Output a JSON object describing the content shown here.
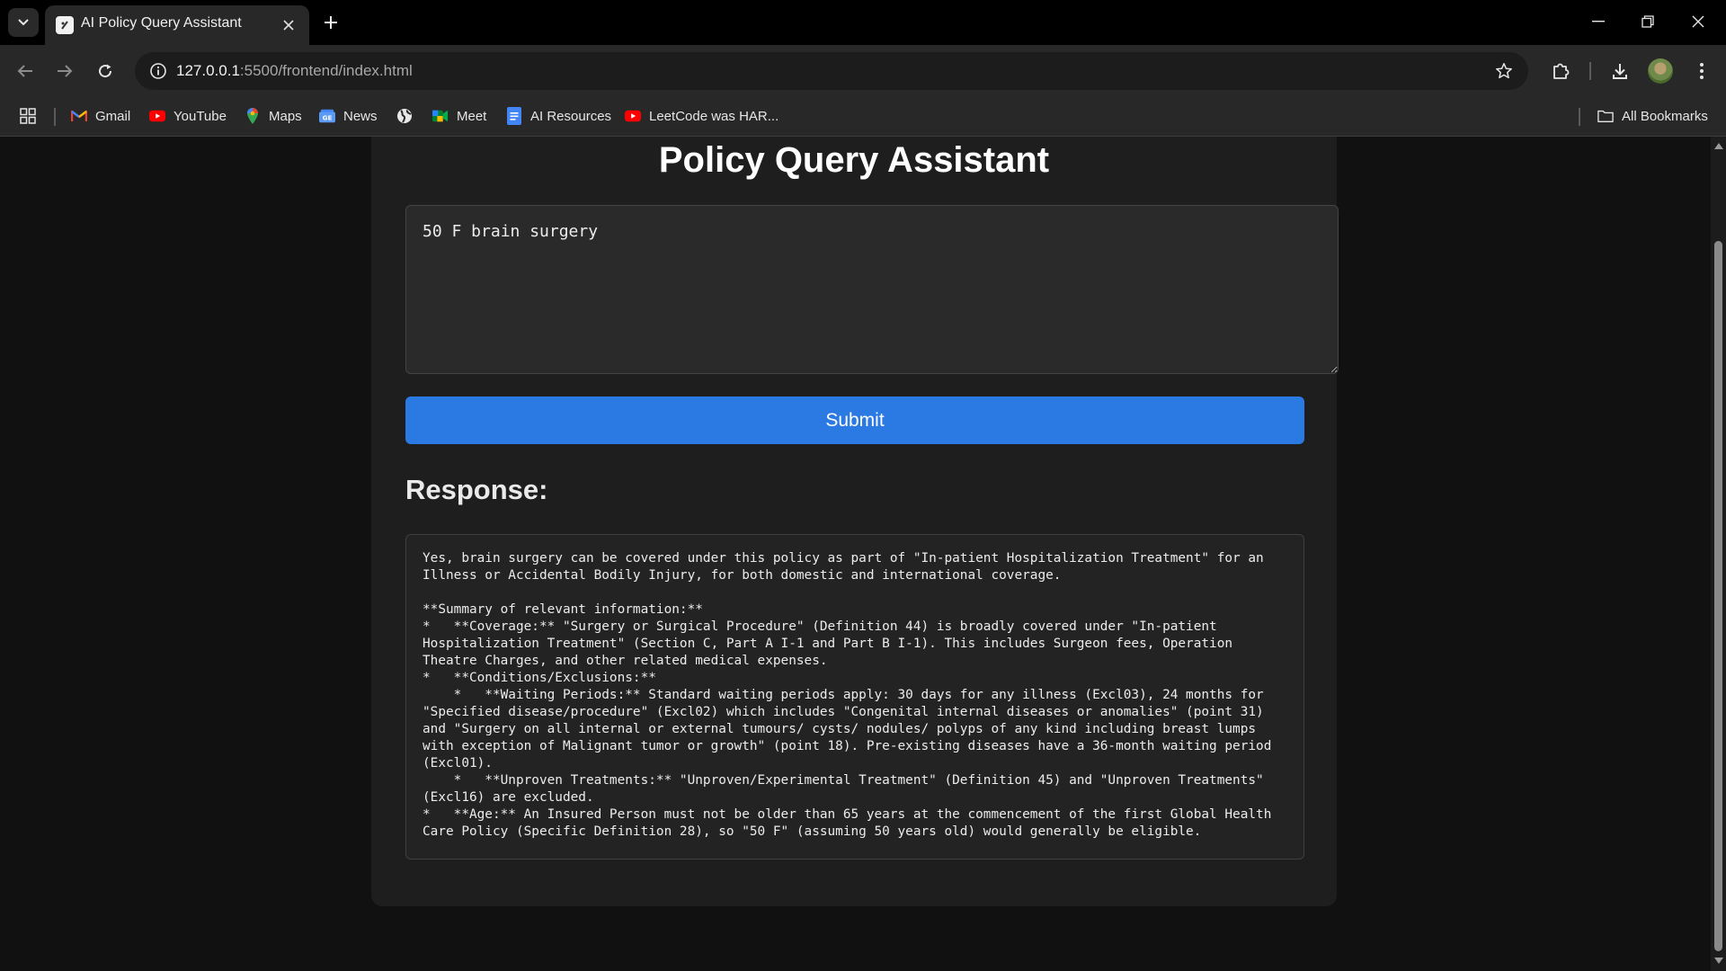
{
  "browser": {
    "tab_title": "AI Policy Query Assistant",
    "url_host": "127.0.0.1",
    "url_rest": ":5500/frontend/index.html",
    "bookmarks": [
      {
        "label": "Gmail",
        "icon": "gmail-icon"
      },
      {
        "label": "YouTube",
        "icon": "youtube-icon"
      },
      {
        "label": "Maps",
        "icon": "maps-icon"
      },
      {
        "label": "News",
        "icon": "news-icon"
      },
      {
        "label": "",
        "icon": "globe-icon"
      },
      {
        "label": "Meet",
        "icon": "meet-icon"
      },
      {
        "label": "AI Resources",
        "icon": "docs-icon"
      },
      {
        "label": "LeetCode was HAR...",
        "icon": "youtube-icon"
      }
    ],
    "all_bookmarks_label": "All Bookmarks"
  },
  "page": {
    "title": "Policy Query Assistant",
    "query_value": "50 F brain surgery",
    "submit_label": "Submit",
    "response_heading": "Response:",
    "response_text": "Yes, brain surgery can be covered under this policy as part of \"In-patient Hospitalization Treatment\" for an Illness or Accidental Bodily Injury, for both domestic and international coverage.\n\n**Summary of relevant information:**\n*   **Coverage:** \"Surgery or Surgical Procedure\" (Definition 44) is broadly covered under \"In-patient Hospitalization Treatment\" (Section C, Part A I-1 and Part B I-1). This includes Surgeon fees, Operation Theatre Charges, and other related medical expenses.\n*   **Conditions/Exclusions:**\n    *   **Waiting Periods:** Standard waiting periods apply: 30 days for any illness (Excl03), 24 months for \"Specified disease/procedure\" (Excl02) which includes \"Congenital internal diseases or anomalies\" (point 31) and \"Surgery on all internal or external tumours/ cysts/ nodules/ polyps of any kind including breast lumps with exception of Malignant tumor or growth\" (point 18). Pre-existing diseases have a 36-month waiting period (Excl01).\n    *   **Unproven Treatments:** \"Unproven/Experimental Treatment\" (Definition 45) and \"Unproven Treatments\" (Excl16) are excluded.\n*   **Age:** An Insured Person must not be older than 65 years at the commencement of the first Global Health Care Policy (Specific Definition 28), so \"50 F\" (assuming 50 years old) would generally be eligible."
  },
  "colors": {
    "accent": "#2b7ae3",
    "page_bg": "#111111",
    "card_bg": "#1e1e1e"
  }
}
